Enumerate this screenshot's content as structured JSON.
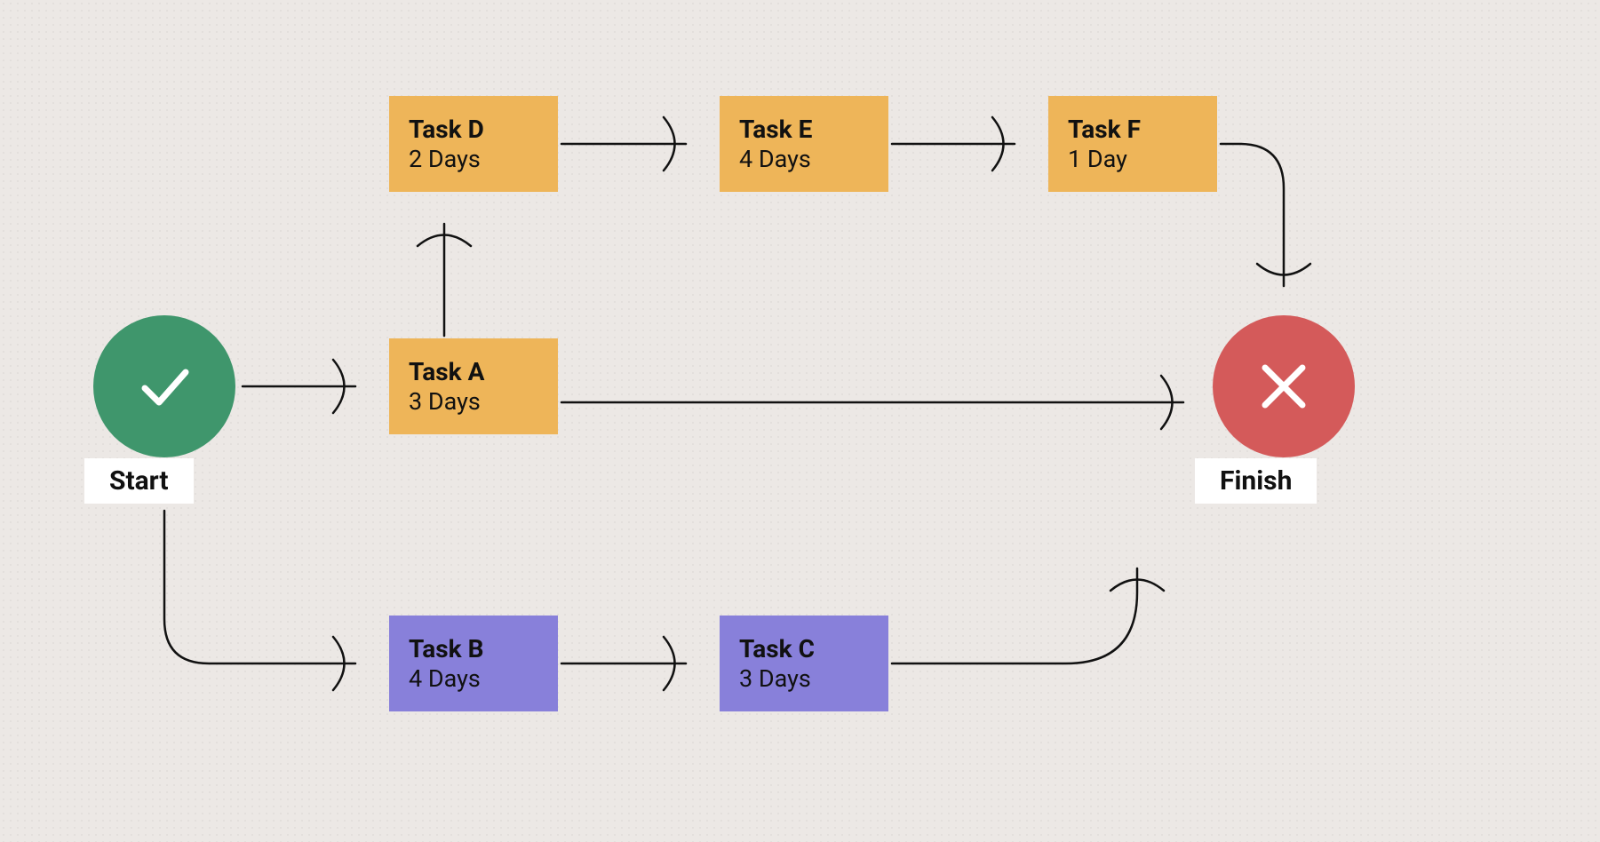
{
  "start": {
    "label": "Start"
  },
  "finish": {
    "label": "Finish"
  },
  "tasks": {
    "a": {
      "title": "Task A",
      "duration": "3 Days"
    },
    "b": {
      "title": "Task B",
      "duration": "4 Days"
    },
    "c": {
      "title": "Task C",
      "duration": "3 Days"
    },
    "d": {
      "title": "Task D",
      "duration": "2 Days"
    },
    "e": {
      "title": "Task E",
      "duration": "4 Days"
    },
    "f": {
      "title": "Task F",
      "duration": "1 Day"
    }
  },
  "colors": {
    "start": "#3f966c",
    "finish": "#d45a5a",
    "orange": "#eeb559",
    "purple": "#8880da",
    "bg": "#ece8e5"
  }
}
